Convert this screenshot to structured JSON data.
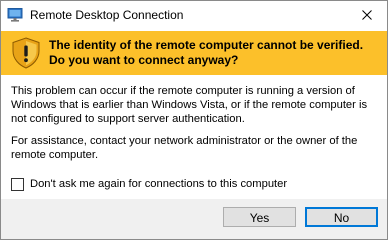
{
  "window": {
    "title": "Remote Desktop Connection",
    "app_icon": "remote-desktop-icon",
    "close_icon": "close-icon"
  },
  "banner": {
    "icon": "shield-warning-icon",
    "heading": "The identity of the remote computer cannot be verified. Do you want to connect anyway?",
    "background": "#fcc02a"
  },
  "message": {
    "paragraph1": "This problem can occur if the remote computer is running a version of Windows that is earlier than Windows Vista, or if the remote computer is not configured to support server authentication.",
    "paragraph2": "For assistance, contact your network administrator or the owner of the remote computer."
  },
  "checkbox": {
    "label": "Don't ask me again for connections to this computer",
    "checked": false
  },
  "buttons": {
    "yes_label": "Yes",
    "no_label": "No",
    "focused": "No",
    "focus_color": "#0078d7"
  }
}
